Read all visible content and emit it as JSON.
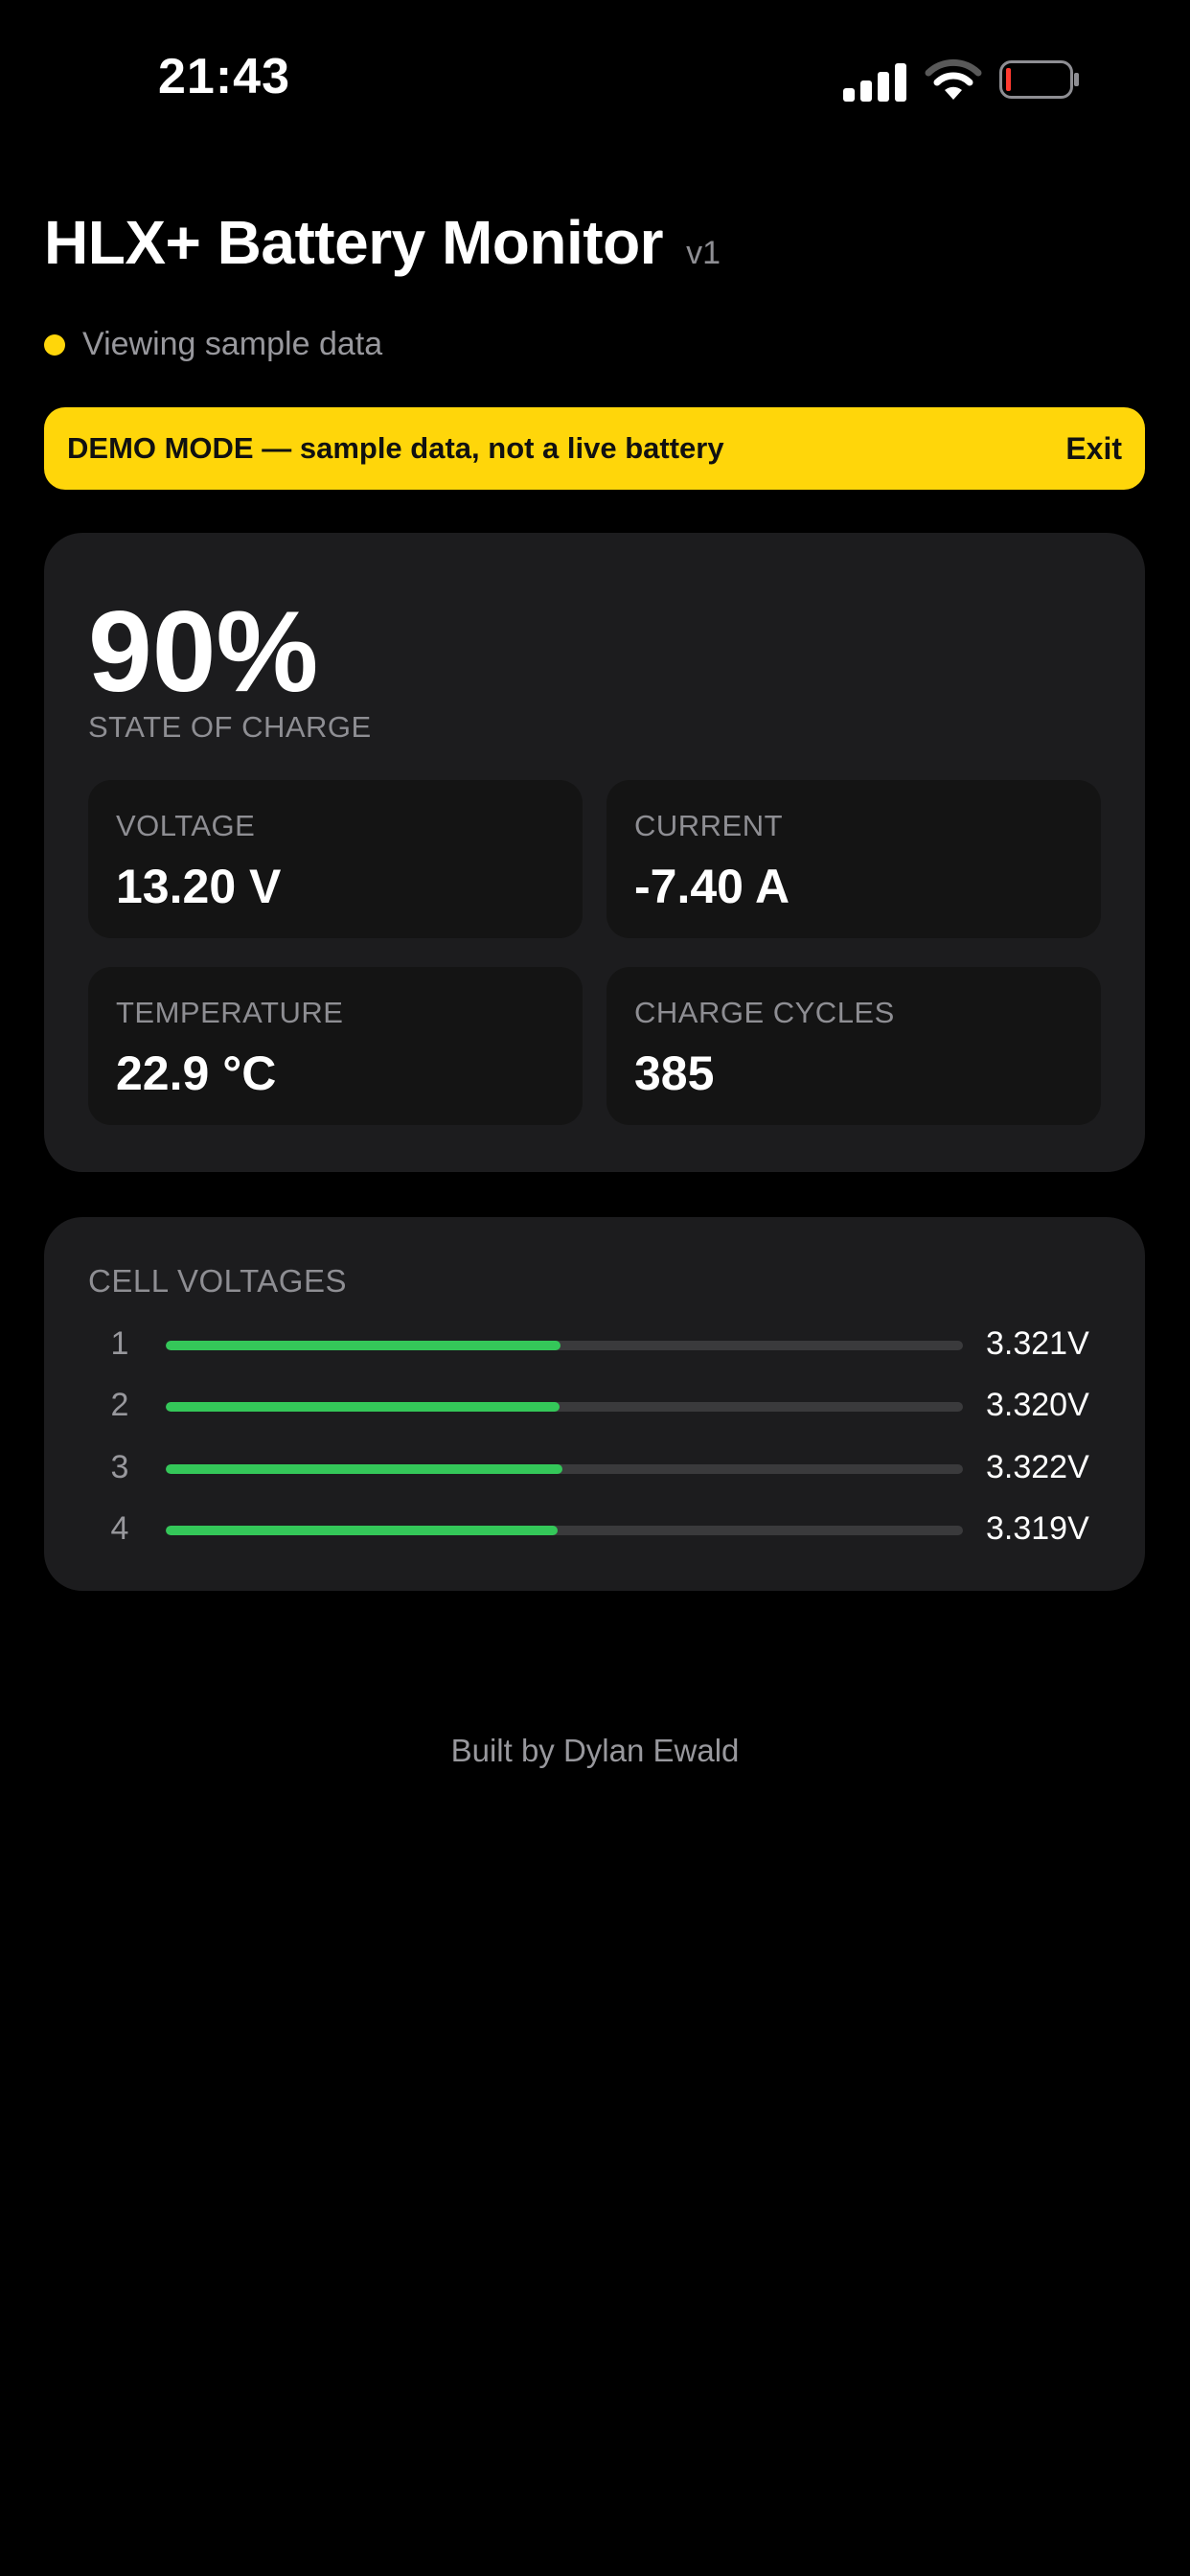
{
  "status_bar": {
    "time": "21:43",
    "signal_icon": "cellular-signal-icon",
    "wifi_icon": "wifi-icon",
    "battery_icon": "low-battery-icon"
  },
  "header": {
    "title": "HLX+ Battery Monitor",
    "version": "v1"
  },
  "connection": {
    "status_text": "Viewing sample data",
    "dot_color": "#ffd60a"
  },
  "demo_banner": {
    "text": "DEMO MODE — sample data, not a live battery",
    "exit_label": "Exit",
    "color": "#ffd60a"
  },
  "summary": {
    "state_of_charge": "90%",
    "state_of_charge_label": "STATE OF CHARGE",
    "metrics": [
      {
        "label": "VOLTAGE",
        "value": "13.20 V"
      },
      {
        "label": "CURRENT",
        "value": "-7.40 A"
      },
      {
        "label": "TEMPERATURE",
        "value": "22.9 °C"
      },
      {
        "label": "CHARGE CYCLES",
        "value": "385"
      }
    ]
  },
  "cells": {
    "title": "CELL VOLTAGES",
    "bar_color": "#34c759",
    "items": [
      {
        "index": "1",
        "value": "3.321V",
        "fill_fraction": 0.495
      },
      {
        "index": "2",
        "value": "3.320V",
        "fill_fraction": 0.494
      },
      {
        "index": "3",
        "value": "3.322V",
        "fill_fraction": 0.498
      },
      {
        "index": "4",
        "value": "3.319V",
        "fill_fraction": 0.491
      }
    ]
  },
  "footer": {
    "text": "Built by Dylan Ewald"
  }
}
